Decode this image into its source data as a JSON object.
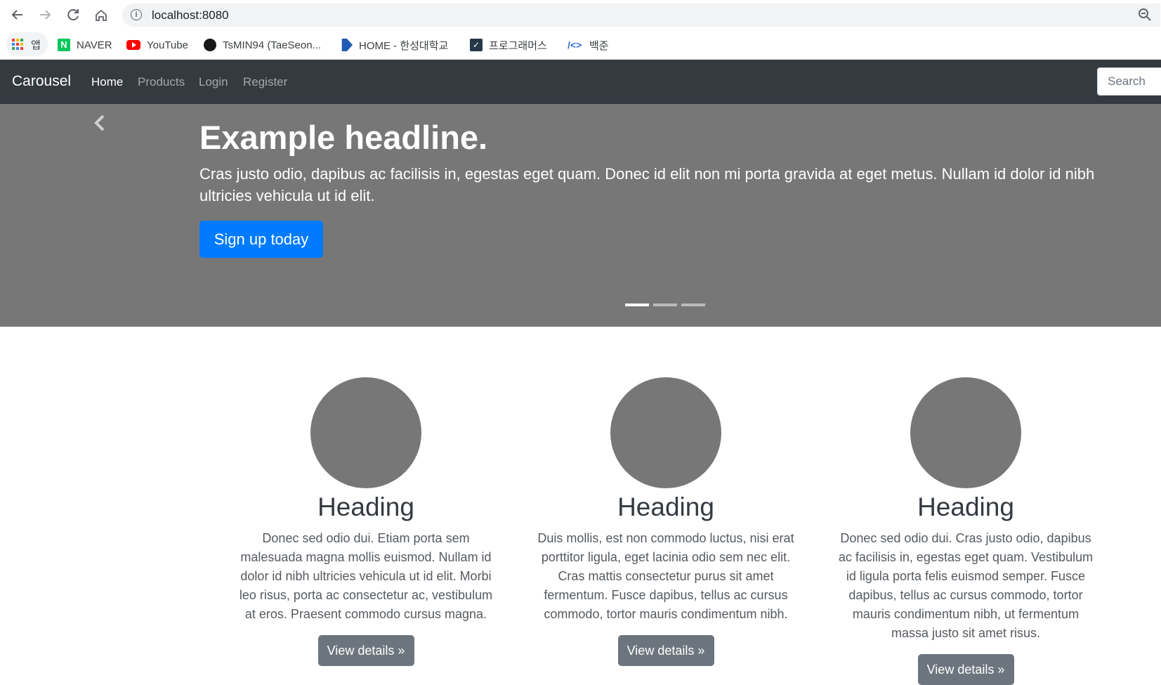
{
  "browser": {
    "url": "localhost:8080",
    "bookmarks": [
      {
        "label": "앱",
        "icon": "apps-grid-icon"
      },
      {
        "label": "NAVER",
        "icon": "naver-icon"
      },
      {
        "label": "YouTube",
        "icon": "youtube-icon"
      },
      {
        "label": "TsMIN94 (TaeSeon...",
        "icon": "github-icon"
      },
      {
        "label": "HOME - 한성대학교",
        "icon": "hansung-icon"
      },
      {
        "label": "프로그래머스",
        "icon": "programmers-icon"
      },
      {
        "label": "백준",
        "icon": "baekjoon-icon"
      }
    ]
  },
  "navbar": {
    "brand": "Carousel",
    "links": [
      {
        "label": "Home",
        "active": true
      },
      {
        "label": "Products",
        "active": false
      },
      {
        "label": "Login",
        "active": false
      },
      {
        "label": "Register",
        "active": false
      }
    ],
    "search_placeholder": "Search"
  },
  "carousel": {
    "headline": "Example headline.",
    "text": "Cras justo odio, dapibus ac facilisis in, egestas eget quam. Donec id elit non mi porta gravida at eget metus. Nullam id dolor id nibh ultricies vehicula ut id elit.",
    "button": "Sign up today",
    "slide_count": 3,
    "active_slide": 1
  },
  "columns": [
    {
      "heading": "Heading",
      "text": "Donec sed odio dui. Etiam porta sem malesuada magna mollis euismod. Nullam id dolor id nibh ultricies vehicula ut id elit. Morbi leo risus, porta ac consectetur ac, vestibulum at eros. Praesent commodo cursus magna.",
      "button": "View details »"
    },
    {
      "heading": "Heading",
      "text": "Duis mollis, est non commodo luctus, nisi erat porttitor ligula, eget lacinia odio sem nec elit. Cras mattis consectetur purus sit amet fermentum. Fusce dapibus, tellus ac cursus commodo, tortor mauris condimentum nibh.",
      "button": "View details »"
    },
    {
      "heading": "Heading",
      "text": "Donec sed odio dui. Cras justo odio, dapibus ac facilisis in, egestas eget quam. Vestibulum id ligula porta felis euismod semper. Fusce dapibus, tellus ac cursus commodo, tortor mauris condimentum nibh, ut fermentum massa justo sit amet risus.",
      "button": "View details »"
    }
  ],
  "colors": {
    "navbar_bg": "#343a40",
    "carousel_bg": "#777777",
    "primary": "#007bff",
    "secondary": "#6c757d"
  }
}
